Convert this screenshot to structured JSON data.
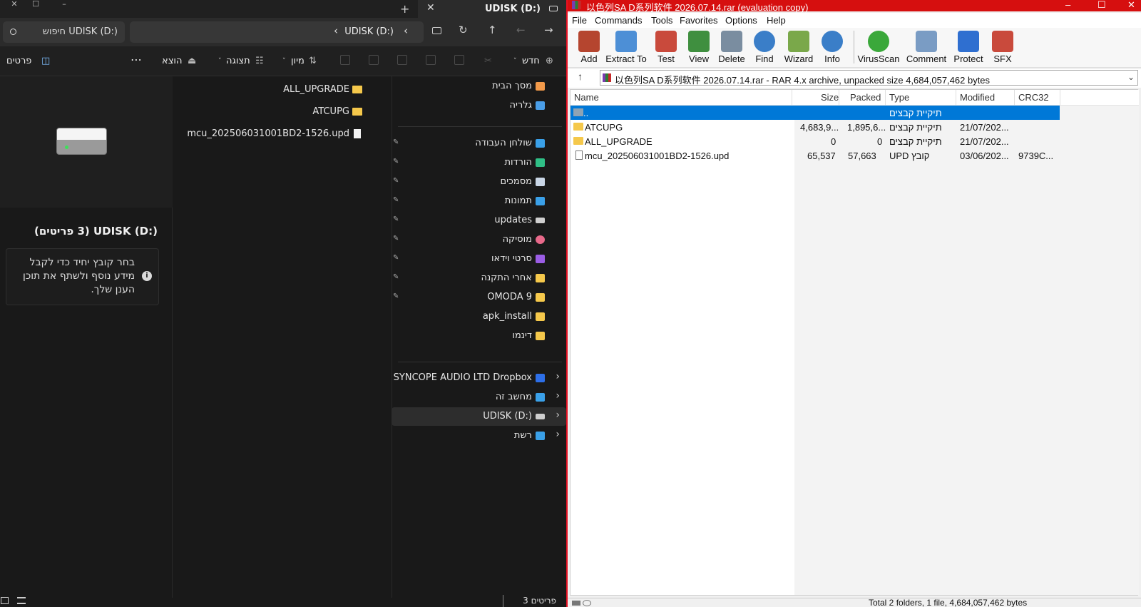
{
  "explorer": {
    "tab_title": "UDISK (D:)",
    "search_placeholder": "חיפוש UDISK (D:)",
    "address_path": "UDISK (D:)",
    "commands": {
      "new": "חדש",
      "sort": "מיון",
      "view": "תצוגה",
      "eject": "הוצא",
      "more": "⋯",
      "details": "פרטים"
    },
    "details_pane": {
      "title": "UDISK (D:) (3 פריטים)",
      "info": "בחר קובץ יחיד כדי לקבל מידע נוסף ולשתף את תוכן הענן שלך."
    },
    "files": [
      {
        "name": "ALL_UPGRADE",
        "kind": "folder"
      },
      {
        "name": "ATCUPG",
        "kind": "folder"
      },
      {
        "name": "mcu_202506031001BD2-1526.upd",
        "kind": "file"
      }
    ],
    "nav_top": [
      {
        "label": "מסך הבית",
        "icon": "home-icon",
        "color": "#f29a4a"
      },
      {
        "label": "גלריה",
        "icon": "gallery-icon",
        "color": "#4a9ee8"
      }
    ],
    "nav_pinned": [
      {
        "label": "שולחן העבודה",
        "icon": "desktop-icon",
        "color": "#3aa0e8"
      },
      {
        "label": "הורדות",
        "icon": "download-icon",
        "color": "#2fbf86"
      },
      {
        "label": "מסמכים",
        "icon": "documents-icon",
        "color": "#c9d6e6"
      },
      {
        "label": "תמונות",
        "icon": "pictures-icon",
        "color": "#3aa0e8"
      },
      {
        "label": "updates",
        "icon": "drive-icon",
        "color": "#cfcfcf"
      },
      {
        "label": "מוסיקה",
        "icon": "music-icon",
        "color": "#e8698a"
      },
      {
        "label": "סרטי וידאו",
        "icon": "videos-icon",
        "color": "#9b5de5"
      },
      {
        "label": "אחרי התקנה",
        "icon": "folder-icon",
        "color": "#f5c84b"
      },
      {
        "label": "OMODA 9",
        "icon": "folder-icon",
        "color": "#f5c84b"
      },
      {
        "label": "apk_install",
        "icon": "folder-icon",
        "color": "#f5c84b"
      },
      {
        "label": "דינמו",
        "icon": "folder-icon",
        "color": "#f5c84b"
      }
    ],
    "nav_bottom": [
      {
        "label": "SYNCOPE AUDIO LTD Dropbox",
        "icon": "dropbox-icon",
        "color": "#2d6fe8"
      },
      {
        "label": "מחשב זה",
        "icon": "computer-icon",
        "color": "#3aa0e8"
      },
      {
        "label": "UDISK (D:)",
        "icon": "drive-icon",
        "color": "#cfcfcf"
      },
      {
        "label": "רשת",
        "icon": "network-icon",
        "color": "#3aa0e8"
      }
    ],
    "status_count": "3 פריטים"
  },
  "winrar": {
    "title": "以色列SA D系列软件 2026.07.14.rar (evaluation copy)",
    "menu": [
      "File",
      "Commands",
      "Tools",
      "Favorites",
      "Options",
      "Help"
    ],
    "toolbar": [
      {
        "label": "Add",
        "icon": "add-archive-icon",
        "color": "#b5452f"
      },
      {
        "label": "Extract To",
        "icon": "extract-folder-icon",
        "color": "#4d8fd6"
      },
      {
        "label": "Test",
        "icon": "test-clipboard-icon",
        "color": "#c94a3c"
      },
      {
        "label": "View",
        "icon": "view-book-icon",
        "color": "#3f8f3f"
      },
      {
        "label": "Delete",
        "icon": "delete-bin-icon",
        "color": "#7a8da0"
      },
      {
        "label": "Find",
        "icon": "find-magnifier-icon",
        "color": "#3a7ec8"
      },
      {
        "label": "Wizard",
        "icon": "wizard-wand-icon",
        "color": "#7aa84a"
      },
      {
        "label": "Info",
        "icon": "info-icon",
        "color": "#3a7ec8"
      },
      {
        "label": "VirusScan",
        "icon": "virusscan-icon",
        "color": "#3aa83a"
      },
      {
        "label": "Comment",
        "icon": "comment-icon",
        "color": "#7a9cc4"
      },
      {
        "label": "Protect",
        "icon": "protect-shield-icon",
        "color": "#2f6fd0"
      },
      {
        "label": "SFX",
        "icon": "sfx-icon",
        "color": "#c94a3c"
      }
    ],
    "path_text": "以色列SA D系列软件 2026.07.14.rar - RAR 4.x archive, unpacked size 4,684,057,462 bytes",
    "columns": [
      "Name",
      "Size",
      "Packed",
      "Type",
      "Modified",
      "CRC32"
    ],
    "rows": [
      {
        "name": "..",
        "size": "",
        "packed": "",
        "type": "תיקיית קבצים",
        "modified": "",
        "crc": "",
        "kind": "up"
      },
      {
        "name": "ATCUPG",
        "size": "4,683,9...",
        "packed": "1,895,6...",
        "type": "תיקיית קבצים",
        "modified": "21/07/202...",
        "crc": "",
        "kind": "folder"
      },
      {
        "name": "ALL_UPGRADE",
        "size": "0",
        "packed": "0",
        "type": "תיקיית קבצים",
        "modified": "21/07/202...",
        "crc": "",
        "kind": "folder"
      },
      {
        "name": "mcu_202506031001BD2-1526.upd",
        "size": "65,537",
        "packed": "57,663",
        "type": "UPD קובץ",
        "modified": "03/06/202...",
        "crc": "9739C...",
        "kind": "file"
      }
    ],
    "status_text": "Total 2 folders, 1 file, 4,684,057,462 bytes"
  }
}
